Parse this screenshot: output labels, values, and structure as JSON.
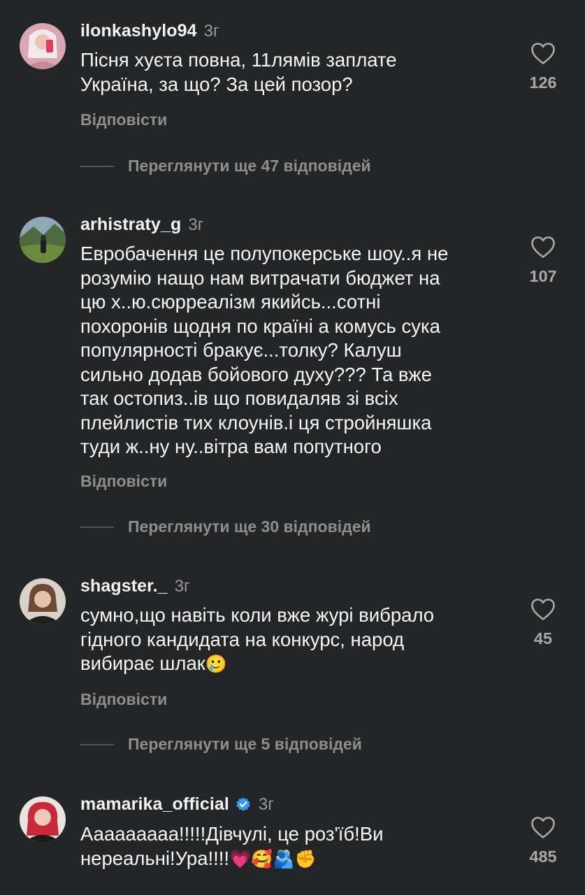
{
  "comments": [
    {
      "username": "ilonkashylo94",
      "time": "3г",
      "lines": [
        "Пісня хуєта повна, 11лямів заплате",
        "Україна, за що? За цей позор?"
      ],
      "likes": "126",
      "reply_label": "Відповісти",
      "view_more": "Переглянути ще 47 відповідей"
    },
    {
      "username": "arhistraty_g",
      "time": "3г",
      "lines": [
        "Евробачення це полупокерське шоу..я не",
        "розумію нащо нам витрачати бюджет на",
        "цю х..ю.сюрреалізм якийсь...сотні",
        "похоронів щодня по країні а комусь сука",
        "популярності бракує...толку? Калуш",
        "сильно додав бойового духу??? Та вже",
        "так остопиз..ів що повидаляв зі всіх",
        "плейлистів тих клоунів.і ця стройняшка",
        "туди ж..ну ну..вітра вам попутного"
      ],
      "likes": "107",
      "reply_label": "Відповісти",
      "view_more": "Переглянути ще 30 відповідей"
    },
    {
      "username": "shagster._",
      "time": "3г",
      "lines": [
        "сумно,що навіть коли вже журі вибрало",
        "гідного кандидата на конкурс, народ",
        "вибирає шлак"
      ],
      "emoji_end": "🥲",
      "likes": "45",
      "reply_label": "Відповісти",
      "view_more": "Переглянути ще 5 відповідей"
    },
    {
      "username": "mamarika_official",
      "time": "3г",
      "verified": true,
      "lines": [
        "Ааааааааа!!!!!Дівчулі, це роз'їб!Ви",
        "нереальні!Ура!!!!"
      ],
      "emoji_end": "💗🥰🫂✊",
      "likes": "485"
    }
  ],
  "icons": {
    "like": "heart-outline-icon",
    "verified": "verified-badge-icon"
  },
  "colors": {
    "background": "#242526",
    "muted": "#8e8e8e",
    "verified": "#3897f0"
  }
}
